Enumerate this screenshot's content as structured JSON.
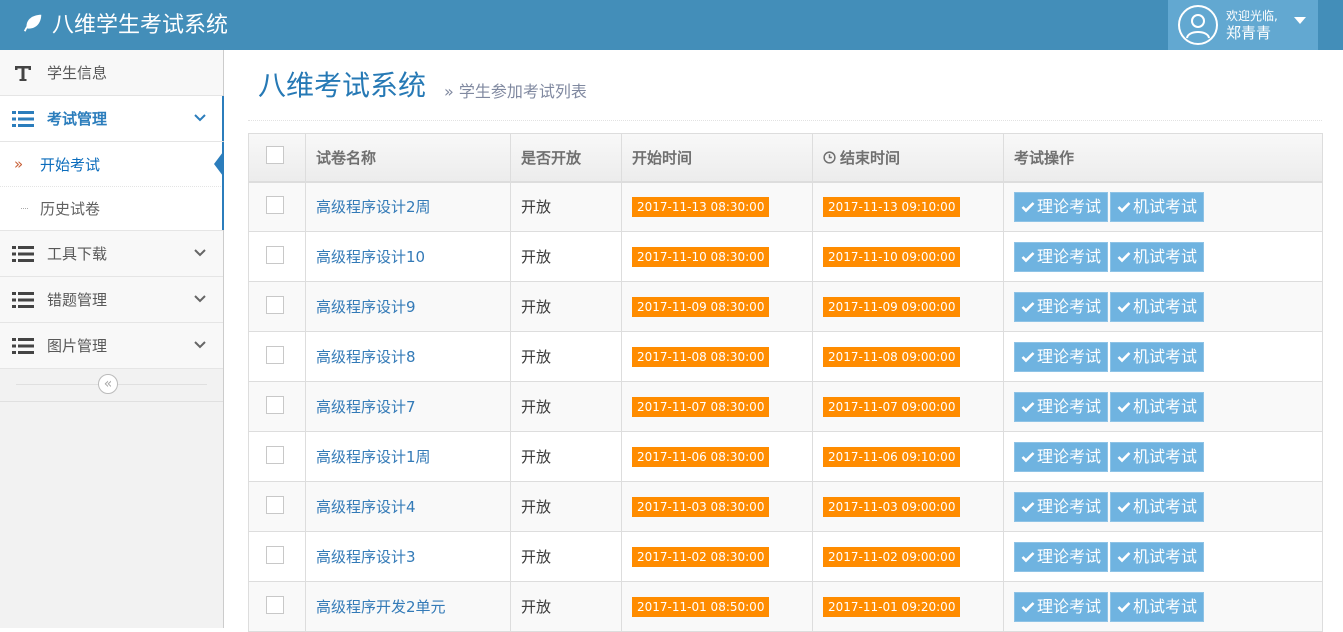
{
  "app": {
    "title": "八维学生考试系统"
  },
  "user": {
    "welcome": "欢迎光临,",
    "name": "郑青青"
  },
  "sidebar": {
    "items": [
      {
        "label": "学生信息",
        "icon": "text-icon"
      },
      {
        "label": "考试管理",
        "icon": "list-icon",
        "open": true,
        "children": [
          {
            "label": "开始考试",
            "active": true
          },
          {
            "label": "历史试卷"
          }
        ]
      },
      {
        "label": "工具下载",
        "icon": "list-icon"
      },
      {
        "label": "错题管理",
        "icon": "list-icon"
      },
      {
        "label": "图片管理",
        "icon": "list-icon"
      }
    ],
    "collapse_label": "«"
  },
  "page": {
    "title": "八维考试系统",
    "breadcrumb_sep": "»",
    "subtitle": "学生参加考试列表"
  },
  "table": {
    "headers": [
      "试卷名称",
      "是否开放",
      "开始时间",
      "结束时间",
      "考试操作"
    ],
    "theory_button": "理论考试",
    "machine_button": "机试考试",
    "rows": [
      {
        "name": "高级程序设计2周",
        "open": "开放",
        "start": "2017-11-13 08:30:00",
        "end": "2017-11-13 09:10:00"
      },
      {
        "name": "高级程序设计10",
        "open": "开放",
        "start": "2017-11-10 08:30:00",
        "end": "2017-11-10 09:00:00"
      },
      {
        "name": "高级程序设计9",
        "open": "开放",
        "start": "2017-11-09 08:30:00",
        "end": "2017-11-09 09:00:00"
      },
      {
        "name": "高级程序设计8",
        "open": "开放",
        "start": "2017-11-08 08:30:00",
        "end": "2017-11-08 09:00:00"
      },
      {
        "name": "高级程序设计7",
        "open": "开放",
        "start": "2017-11-07 08:30:00",
        "end": "2017-11-07 09:00:00"
      },
      {
        "name": "高级程序设计1周",
        "open": "开放",
        "start": "2017-11-06 08:30:00",
        "end": "2017-11-06 09:10:00"
      },
      {
        "name": "高级程序设计4",
        "open": "开放",
        "start": "2017-11-03 08:30:00",
        "end": "2017-11-03 09:00:00"
      },
      {
        "name": "高级程序设计3",
        "open": "开放",
        "start": "2017-11-02 08:30:00",
        "end": "2017-11-02 09:00:00"
      },
      {
        "name": "高级程序开发2单元",
        "open": "开放",
        "start": "2017-11-01 08:50:00",
        "end": "2017-11-01 09:20:00"
      }
    ]
  },
  "colors": {
    "navbar": "#438eb9",
    "user_box": "#62a8d1",
    "accent": "#2b7dbc",
    "time_tag": "#ff8c00",
    "action_button": "#6fb3e0"
  }
}
